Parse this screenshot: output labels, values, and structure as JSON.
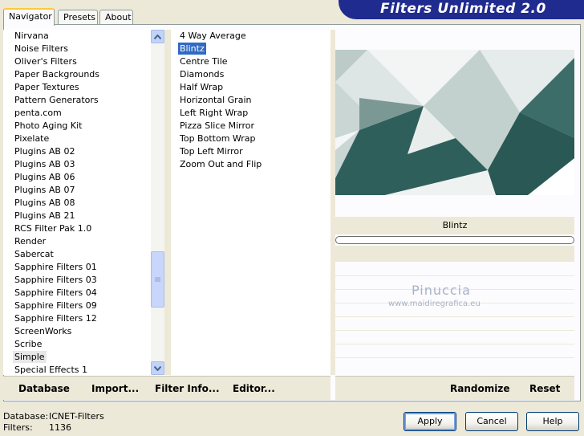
{
  "tabs": [
    {
      "label": "Navigator"
    },
    {
      "label": "Presets"
    },
    {
      "label": "About"
    }
  ],
  "app_title": "Filters Unlimited 2.0",
  "categories": [
    "Nirvana",
    "Noise Filters",
    "Oliver's Filters",
    "Paper Backgrounds",
    "Paper Textures",
    "Pattern Generators",
    "penta.com",
    "Photo Aging Kit",
    "Pixelate",
    "Plugins AB 02",
    "Plugins AB 03",
    "Plugins AB 06",
    "Plugins AB 07",
    "Plugins AB 08",
    "Plugins AB 21",
    "RCS Filter Pak 1.0",
    "Render",
    "Sabercat",
    "Sapphire Filters 01",
    "Sapphire Filters 03",
    "Sapphire Filters 04",
    "Sapphire Filters 09",
    "Sapphire Filters 12",
    "ScreenWorks",
    "Scribe",
    "Simple",
    "Special Effects 1"
  ],
  "selected_category": "Simple",
  "filters": [
    "4 Way Average",
    "Blintz",
    "Centre Tile",
    "Diamonds",
    "Half Wrap",
    "Horizontal Grain",
    "Left Right Wrap",
    "Pizza Slice Mirror",
    "Top Bottom Wrap",
    "Top Left Mirror",
    "Zoom Out and Flip"
  ],
  "selected_filter": "Blintz",
  "current_filter_name": "Blintz",
  "watermark": {
    "name": "Pinuccia",
    "url": "www.maidiregrafica.eu"
  },
  "left_buttons": {
    "database": "Database",
    "import": "Import...",
    "filter_info": "Filter Info...",
    "editor": "Editor..."
  },
  "right_buttons": {
    "randomize": "Randomize",
    "reset": "Reset"
  },
  "status": {
    "database_label": "Database:",
    "database_value": "ICNET-Filters",
    "filters_label": "Filters:",
    "filters_value": "1136"
  },
  "dialog_buttons": {
    "apply": "Apply",
    "cancel": "Cancel",
    "help": "Help"
  },
  "colors": {
    "title_banner": "#1f2b8e",
    "selection": "#316ac5",
    "preview_teal": "#2f5f5b"
  }
}
